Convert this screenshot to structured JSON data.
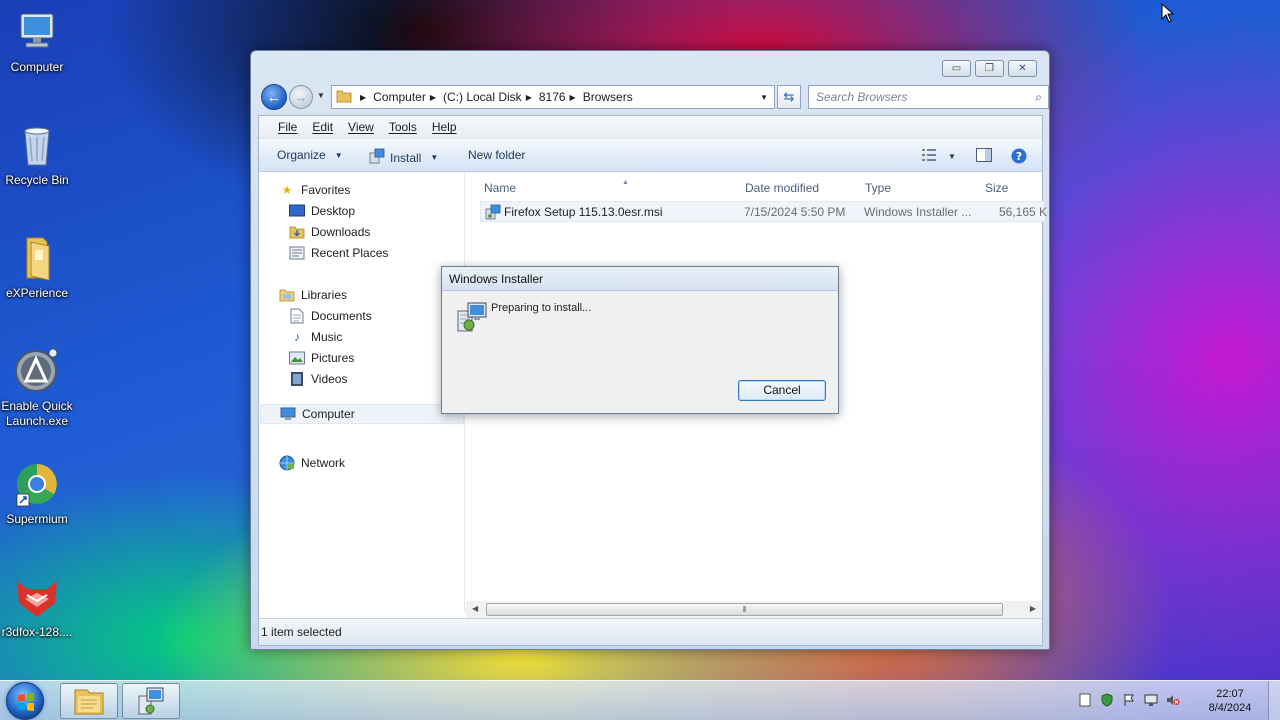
{
  "desktop": {
    "icons": [
      {
        "label": "Computer",
        "icon": "computer-icon"
      },
      {
        "label": "Recycle Bin",
        "icon": "recycle-bin-icon"
      },
      {
        "label": "eXPerience",
        "icon": "folder-icon"
      },
      {
        "label": "Enable Quick Launch.exe",
        "icon": "quick-launch-icon"
      },
      {
        "label": "Supermium",
        "icon": "supermium-browser-icon"
      },
      {
        "label": "r3dfox-128....",
        "icon": "r3dfox-icon"
      }
    ]
  },
  "explorer": {
    "address": {
      "crumbs": [
        "Computer",
        "(C:) Local Disk",
        "8176",
        "Browsers"
      ]
    },
    "search": {
      "placeholder": "Search Browsers"
    },
    "menu": {
      "file": "File",
      "edit": "Edit",
      "view": "View",
      "tools": "Tools",
      "help": "Help"
    },
    "toolbar": {
      "organize": "Organize",
      "install": "Install",
      "new_folder": "New folder"
    },
    "nav": {
      "favorites": "Favorites",
      "desktop": "Desktop",
      "downloads": "Downloads",
      "recent_places": "Recent Places",
      "libraries": "Libraries",
      "documents": "Documents",
      "music": "Music",
      "pictures": "Pictures",
      "videos": "Videos",
      "computer": "Computer",
      "network": "Network"
    },
    "columns": {
      "name": "Name",
      "date_modified": "Date modified",
      "type": "Type",
      "size": "Size"
    },
    "files": [
      {
        "name": "Firefox Setup 115.13.0esr.msi",
        "date_modified": "7/15/2024 5:50 PM",
        "type": "Windows Installer ...",
        "size": "56,165 K"
      }
    ],
    "status": "1 item selected"
  },
  "dialog": {
    "title": "Windows Installer",
    "message": "Preparing to install...",
    "cancel_label": "Cancel"
  },
  "taskbar": {
    "clock_time": "22:07",
    "clock_date": "8/4/2024"
  },
  "colors": {
    "accent": "#1d5fc4",
    "selection": "#f0f4fa"
  }
}
